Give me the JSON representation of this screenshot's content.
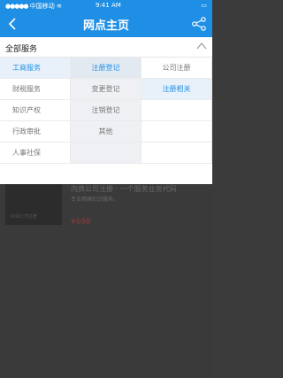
{
  "status": {
    "carrier": "中国移动",
    "time": "9:41 AM"
  },
  "nav": {
    "title": "网点主页"
  },
  "panel": {
    "title": "全部服务",
    "rows": [
      [
        "工商服务",
        "注册登记",
        "公司注册"
      ],
      [
        "财税服务",
        "变更登记",
        "注册相关"
      ],
      [
        "知识产权",
        "注销登记",
        ""
      ],
      [
        "行政审批",
        "其他",
        ""
      ],
      [
        "人事社保",
        "",
        ""
      ]
    ]
  },
  "course": {
    "title": "内资公司注册 · 一个服务业务代码",
    "desc": "专业精确知识服务。",
    "price": "¥698",
    "thumb_label": "内资公司注册"
  },
  "colors": {
    "primary": "#1f8fe6",
    "price": "#8b3a3a"
  }
}
